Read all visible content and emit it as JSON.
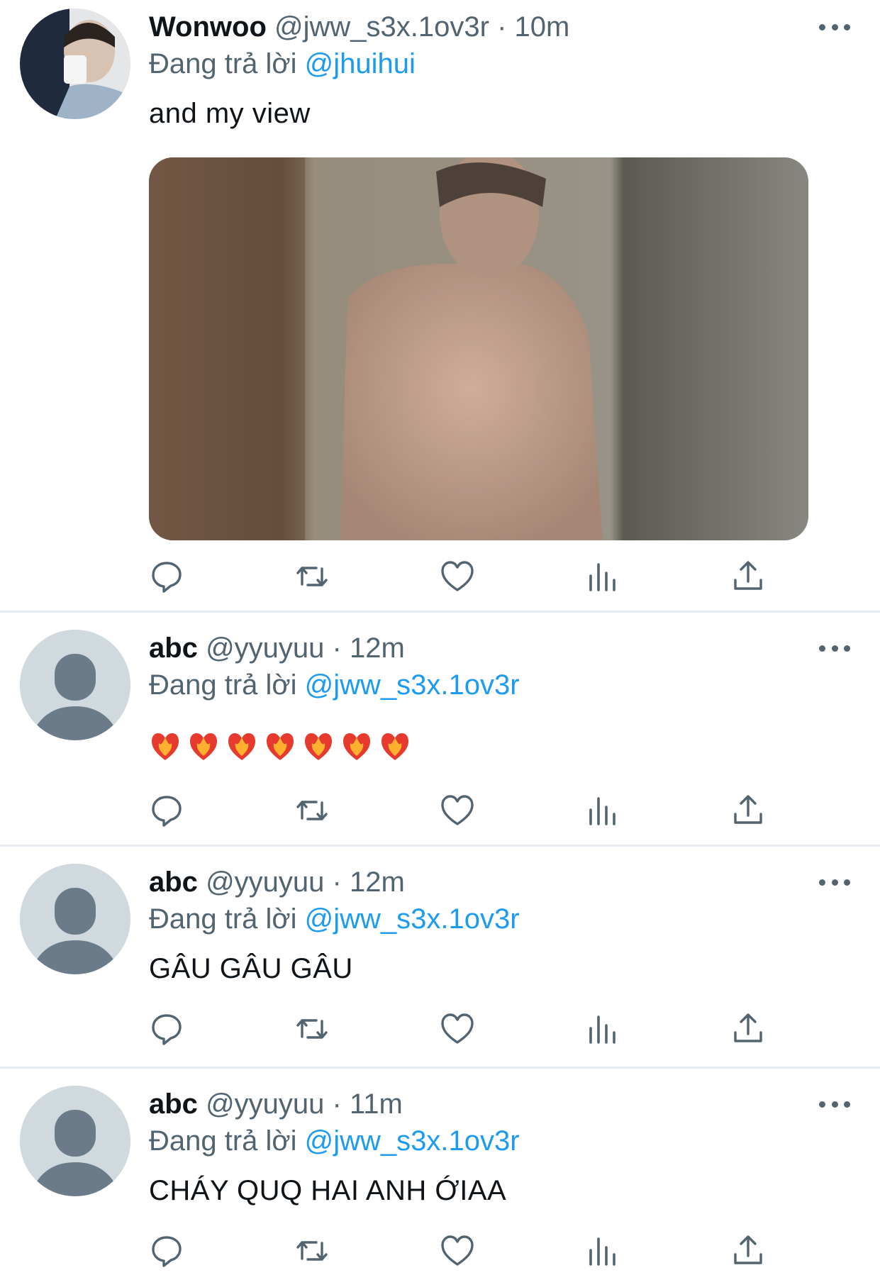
{
  "tweets": [
    {
      "name": "Wonwoo",
      "handle": "@jww_s3x.1ov3r",
      "separator": "·",
      "time": "10m",
      "reply_prefix": "Đang trả lời",
      "reply_to": "@jhuihui",
      "text": "and my view",
      "has_media": true,
      "avatar": "profile-photo"
    },
    {
      "name": "abc",
      "handle": "@yyuyuu",
      "separator": "·",
      "time": "12m",
      "reply_prefix": "Đang trả lời",
      "reply_to": "@jww_s3x.1ov3r",
      "emoji": "heart-on-fire",
      "emoji_count": 7,
      "avatar": "default-avatar"
    },
    {
      "name": "abc",
      "handle": "@yyuyuu",
      "separator": "·",
      "time": "12m",
      "reply_prefix": "Đang trả lời",
      "reply_to": "@jww_s3x.1ov3r",
      "text": "GÂU GÂU GÂU",
      "avatar": "default-avatar"
    },
    {
      "name": "abc",
      "handle": "@yyuyuu",
      "separator": "·",
      "time": "11m",
      "reply_prefix": "Đang trả lời",
      "reply_to": "@jww_s3x.1ov3r",
      "text": "CHÁY QUQ HAI ANH ỚIAA",
      "avatar": "default-avatar"
    }
  ],
  "action_icons": [
    "reply-icon",
    "retweet-icon",
    "like-icon",
    "analytics-icon",
    "share-icon"
  ],
  "colors": {
    "text": "#0f1419",
    "secondary": "#536471",
    "link": "#1d9bf0",
    "divider": "#e6ecf0",
    "default_avatar_bg": "#cfd9de",
    "default_avatar_fg": "#6b7b8a"
  }
}
